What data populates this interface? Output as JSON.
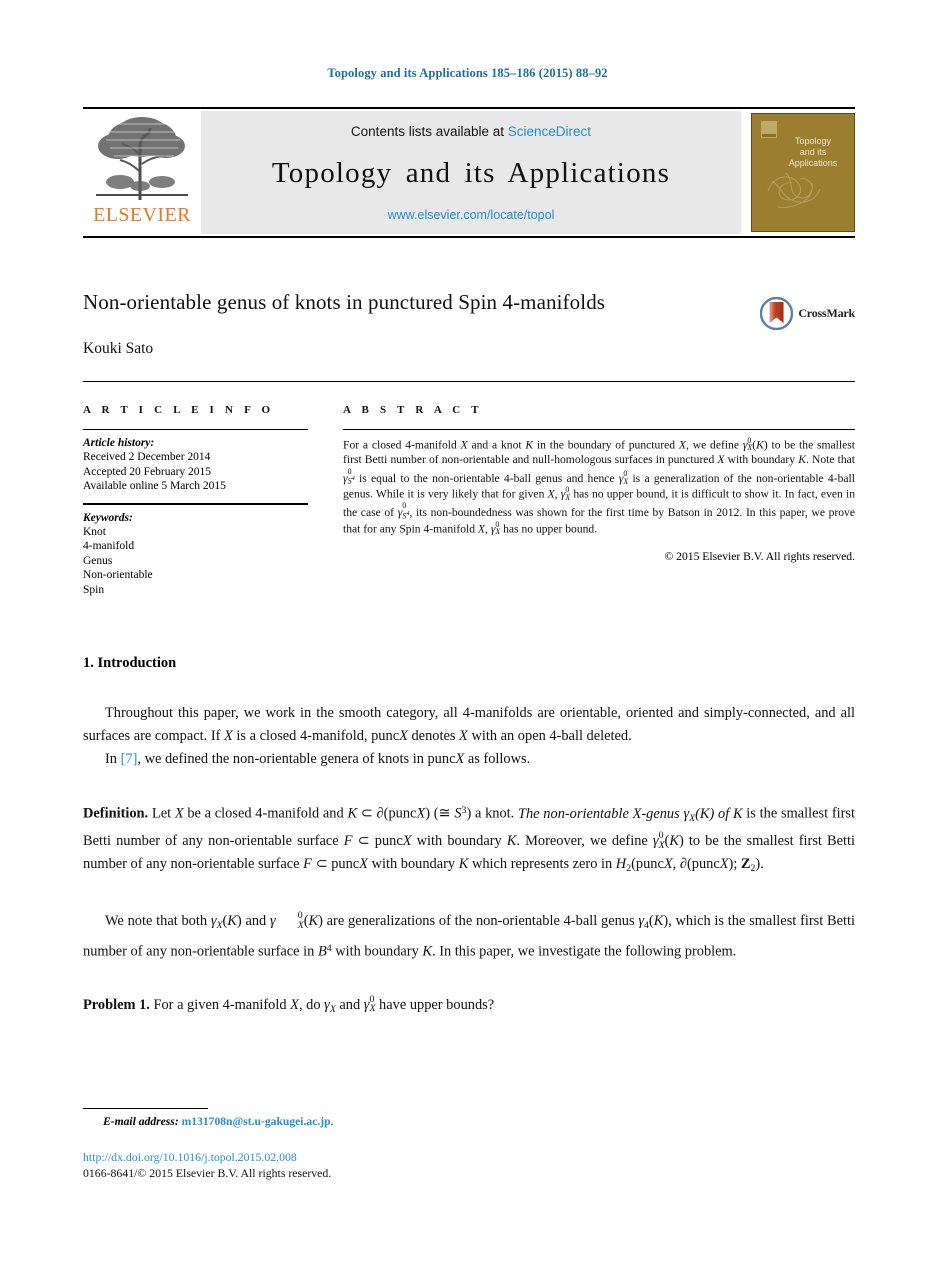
{
  "running_head": "Topology and its Applications 185–186 (2015) 88–92",
  "masthead": {
    "publisher_name": "ELSEVIER",
    "contents_prefix": "Contents lists available at",
    "contents_link": "ScienceDirect",
    "journal_title": "Topology and its Applications",
    "journal_url": "www.elsevier.com/locate/topol",
    "cover_title_line1": "Topology",
    "cover_title_line2": "and its",
    "cover_title_line3": "Applications",
    "cover_color": "#9c7e31",
    "elsevier_orange": "#e87722",
    "link_blue": "#2a8ec4"
  },
  "title_block": {
    "title": "Non-orientable genus of knots in punctured Spin 4-manifolds",
    "author": "Kouki Sato",
    "crossmark_label": "CrossMark"
  },
  "article_info": {
    "section_label": "A R T I C L E   I N F O",
    "history_heading": "Article history:",
    "history": [
      "Received 2 December 2014",
      "Accepted 20 February 2015",
      "Available online 5 March 2015"
    ],
    "keywords_heading": "Keywords:",
    "keywords": [
      "Knot",
      "4-manifold",
      "Genus",
      "Non-orientable",
      "Spin"
    ]
  },
  "abstract": {
    "section_label": "A B S T R A C T",
    "p1_a": "For a closed 4-manifold ",
    "p1_b": " and a knot ",
    "p1_c": " in the boundary of punctured ",
    "p1_d": ", we define ",
    "p1_e": " to be the smallest first Betti number of non-orientable and null-homologous surfaces in punctured ",
    "p1_f": " with boundary ",
    "p1_g": ". Note that ",
    "p1_h": " is equal to the non-orientable 4-ball genus and hence ",
    "p1_i": " is a generalization of the non-orientable 4-ball genus. While it is very likely that for given ",
    "p1_j": ", ",
    "p1_k": " has no upper bound, it is difficult to show it. In fact, even in the case of ",
    "p1_l": ", its non-boundedness was shown for the first time by Batson in 2012. In this paper, we prove that for any Spin 4-manifold ",
    "p1_m": ", ",
    "p1_n": " has no upper bound.",
    "copyright": "© 2015 Elsevier B.V. All rights reserved."
  },
  "sections": {
    "intro_heading": "1.  Introduction",
    "intro_p1_a": "Throughout this paper, we work in the smooth category, all 4-manifolds are orientable, oriented and simply-connected, and all surfaces are compact. If ",
    "intro_p1_b": " is a closed 4-manifold, punc",
    "intro_p1_c": " denotes ",
    "intro_p1_d": " with an open 4-ball deleted.",
    "intro_p2_a": "In ",
    "intro_p2_ref": "[7]",
    "intro_p2_b": ", we defined the non-orientable genera of knots in punc",
    "intro_p2_c": " as follows.",
    "definition_label": "Definition.",
    "def_a": " Let ",
    "def_b": " be a closed 4-manifold and ",
    "def_c": " ⊂ ∂(punc",
    "def_d": ") (≅ ",
    "def_e": ") a knot. ",
    "def_italic1": "The non-orientable ",
    "def_italic2": "-genus ",
    "def_italic3": " of ",
    "def_f": " is the smallest first Betti number of any non-orientable surface ",
    "def_g": " ⊂ punc",
    "def_h": " with boundary ",
    "def_i": ". Moreover, we define ",
    "def_j": " to be the smallest first Betti number of any non-orientable surface ",
    "def_k": " ⊂ punc",
    "def_l": " with boundary ",
    "def_m": " which represents zero in ",
    "def_n": "(punc",
    "def_o": ", ∂(punc",
    "def_p": "); ",
    "def_q": ").",
    "note_a": "We note that both ",
    "note_b": " and ",
    "note_c": " are generalizations of the non-orientable 4-ball genus ",
    "note_d": ", which is the smallest first Betti number of any non-orientable surface in ",
    "note_e": " with boundary ",
    "note_f": ". In this paper, we investigate the following problem.",
    "problem_label": "Problem 1.",
    "problem_a": " For a given 4-manifold ",
    "problem_b": ", do ",
    "problem_c": " and ",
    "problem_d": " have upper bounds?"
  },
  "footer": {
    "email_label": "E-mail address:",
    "email": "m131708n@st.u-gakugei.ac.jp",
    "email_period": ".",
    "doi": "http://dx.doi.org/10.1016/j.topol.2015.02.008",
    "issn_line": "0166-8641/© 2015 Elsevier B.V. All rights reserved."
  }
}
